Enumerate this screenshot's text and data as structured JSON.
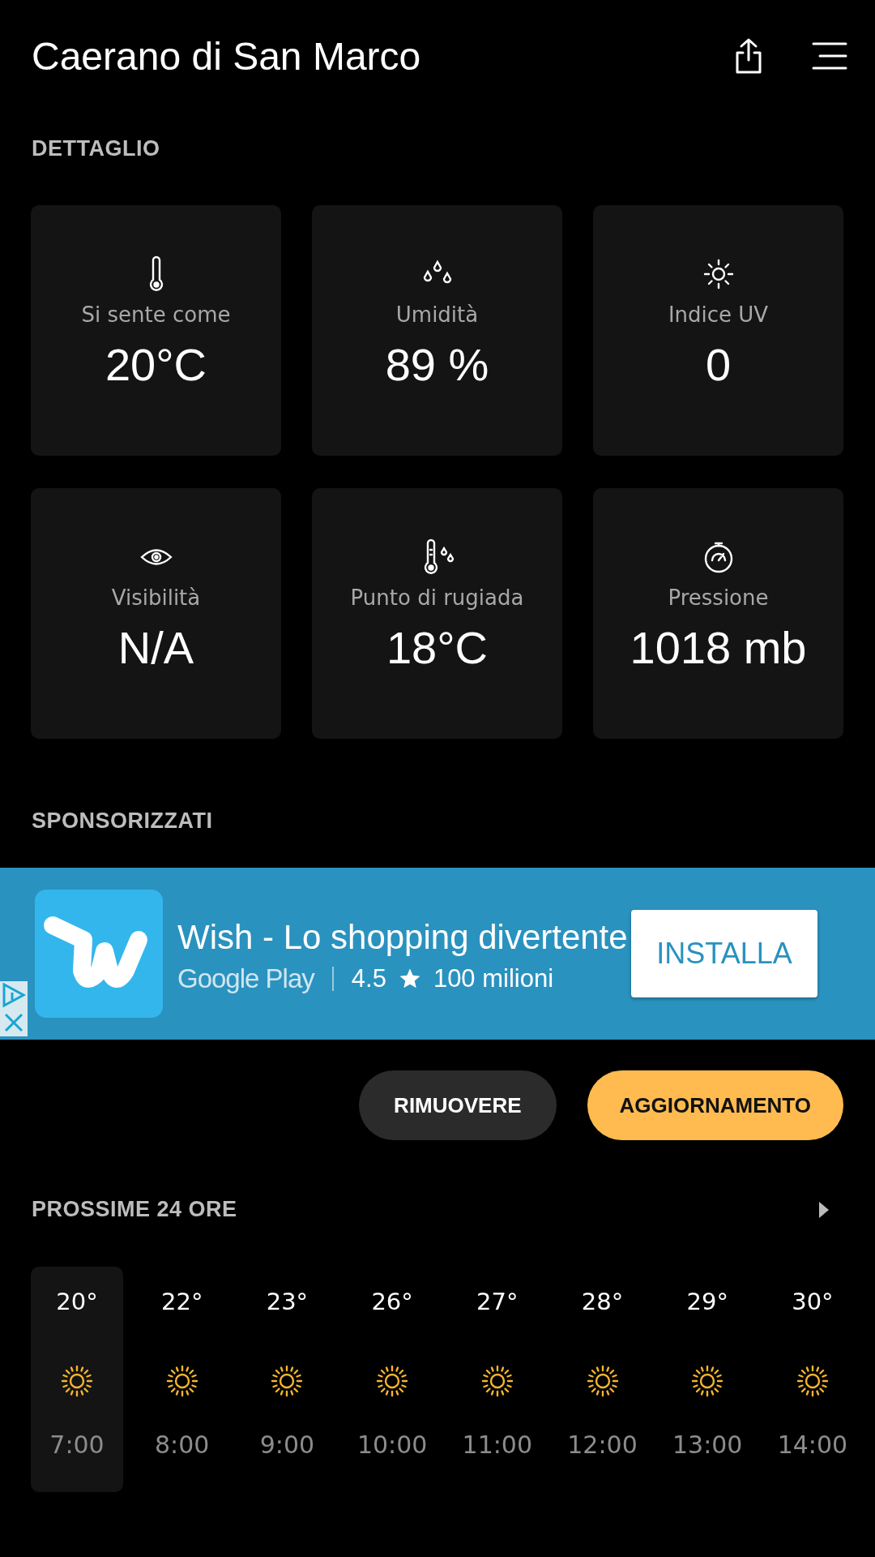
{
  "header": {
    "title": "Caerano di San Marco"
  },
  "details": {
    "heading": "DETTAGLIO",
    "cards": [
      {
        "kind": "thermometer",
        "label": "Si sente come",
        "value": "20°C"
      },
      {
        "kind": "humidity",
        "label": "Umidità",
        "value": "89 %"
      },
      {
        "kind": "uv",
        "label": "Indice UV",
        "value": "0"
      },
      {
        "kind": "visibility",
        "label": "Visibilità",
        "value": "N/A"
      },
      {
        "kind": "dewpoint",
        "label": "Punto di rugiada",
        "value": "18°C"
      },
      {
        "kind": "pressure",
        "label": "Pressione",
        "value": "1018 mb"
      }
    ]
  },
  "sponsored": {
    "heading": "SPONSORIZZATI",
    "ad": {
      "title": "Wish - Lo shopping divertente",
      "store": "Google Play",
      "rating": "4.5",
      "downloads": "100 milioni",
      "install": "INSTALLA"
    },
    "buttons": [
      {
        "kind": "secondary",
        "label": "RIMUOVERE"
      },
      {
        "kind": "primary",
        "label": "AGGIORNAMENTO"
      }
    ]
  },
  "forecast": {
    "heading": "PROSSIME 24 ORE",
    "hours": [
      {
        "temp": "20°",
        "time": "7:00",
        "selected": true
      },
      {
        "temp": "22°",
        "time": "8:00",
        "selected": false
      },
      {
        "temp": "23°",
        "time": "9:00",
        "selected": false
      },
      {
        "temp": "26°",
        "time": "10:00",
        "selected": false
      },
      {
        "temp": "27°",
        "time": "11:00",
        "selected": false
      },
      {
        "temp": "28°",
        "time": "12:00",
        "selected": false
      },
      {
        "temp": "29°",
        "time": "13:00",
        "selected": false
      },
      {
        "temp": "30°",
        "time": "14:00",
        "selected": false
      }
    ]
  }
}
